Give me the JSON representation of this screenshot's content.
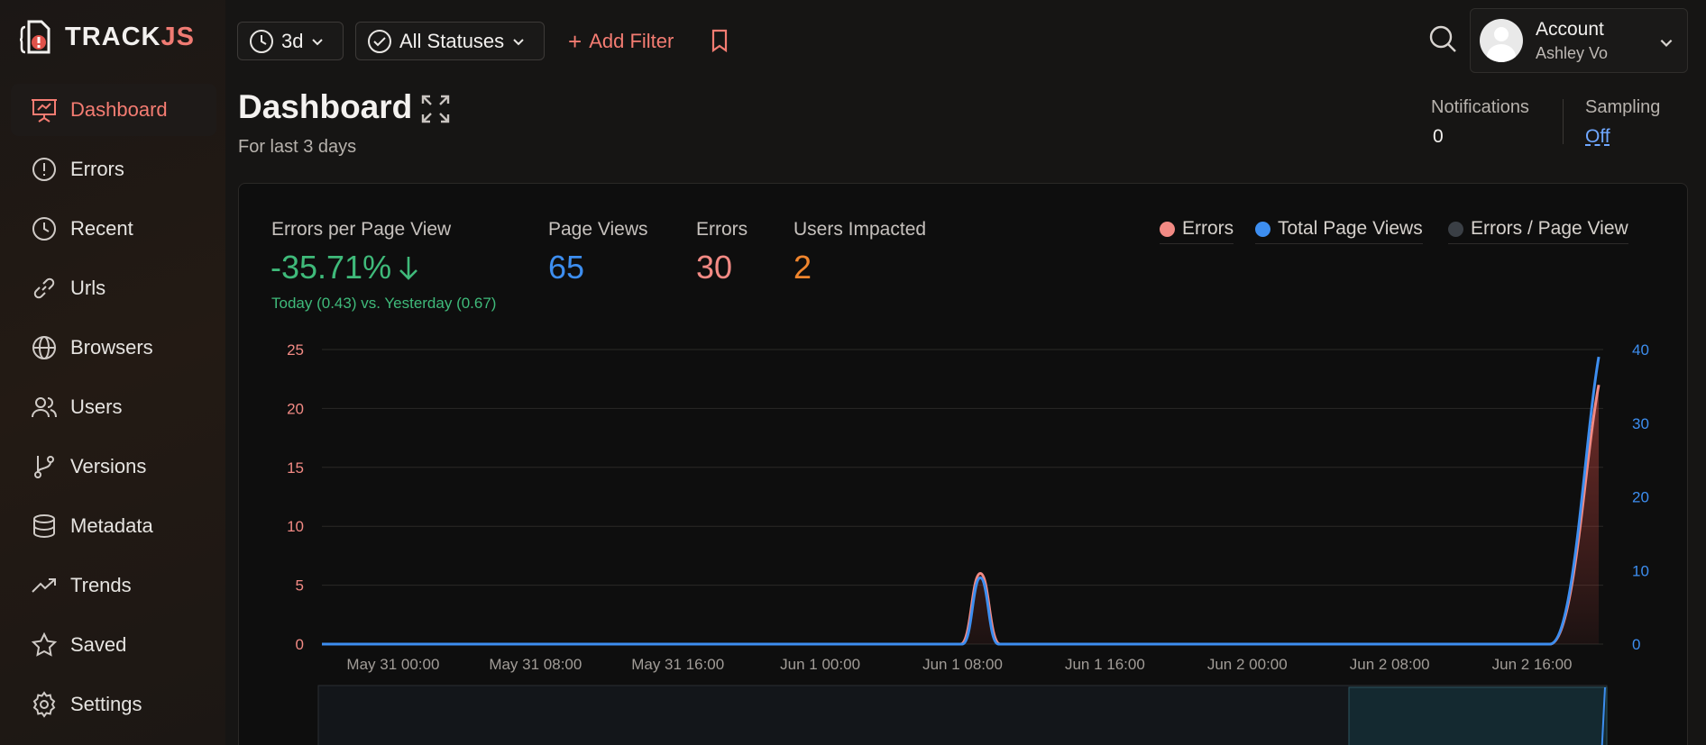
{
  "app": {
    "logo_prefix": "TRACK",
    "logo_suffix": "JS"
  },
  "sidebar": {
    "items": [
      {
        "label": "Dashboard",
        "icon": "presentation-icon",
        "active": true
      },
      {
        "label": "Errors",
        "icon": "alert-circle-icon"
      },
      {
        "label": "Recent",
        "icon": "clock-icon"
      },
      {
        "label": "Urls",
        "icon": "link-icon"
      },
      {
        "label": "Browsers",
        "icon": "globe-icon"
      },
      {
        "label": "Users",
        "icon": "users-icon"
      },
      {
        "label": "Versions",
        "icon": "git-branch-icon"
      },
      {
        "label": "Metadata",
        "icon": "database-icon"
      },
      {
        "label": "Trends",
        "icon": "trending-up-icon"
      },
      {
        "label": "Saved",
        "icon": "star-icon"
      },
      {
        "label": "Settings",
        "icon": "gear-icon"
      }
    ]
  },
  "toolbar": {
    "time_range": "3d",
    "status_filter": "All Statuses",
    "add_filter": "Add Filter"
  },
  "account": {
    "title": "Account",
    "name": "Ashley Vo"
  },
  "header": {
    "title": "Dashboard",
    "subtitle": "For last 3 days",
    "notifications_label": "Notifications",
    "notifications_value": "0",
    "sampling_label": "Sampling",
    "sampling_value": "Off"
  },
  "metrics": {
    "epv_label": "Errors per Page View",
    "epv_value": "-35.71%",
    "epv_compare": "Today (0.43) vs. Yesterday (0.67)",
    "pv_label": "Page Views",
    "pv_value": "65",
    "errors_label": "Errors",
    "errors_value": "30",
    "users_label": "Users Impacted",
    "users_value": "2"
  },
  "legend": {
    "errors": "Errors",
    "page_views": "Total Page Views",
    "epv": "Errors / Page View"
  },
  "colors": {
    "errors": "#f28a84",
    "page_views": "#3d8ef0",
    "epv": "#3a3f45",
    "positive": "#3fba7a",
    "accent": "#f47c72",
    "users": "#f0852d"
  },
  "chart_data": {
    "type": "line",
    "x_ticks": [
      "May 31 00:00",
      "May 31 08:00",
      "May 31 16:00",
      "Jun 1 00:00",
      "Jun 1 08:00",
      "Jun 1 16:00",
      "Jun 2 00:00",
      "Jun 2 08:00",
      "Jun 2 16:00"
    ],
    "x_range": [
      "May 30 20:00",
      "Jun 2 20:00"
    ],
    "y_left": {
      "range": [
        0,
        25
      ],
      "ticks": [
        0,
        5,
        10,
        15,
        20,
        25
      ]
    },
    "y_right": {
      "range": [
        0,
        40
      ],
      "ticks": [
        0,
        10,
        20,
        30,
        40
      ]
    },
    "series": [
      {
        "name": "Errors",
        "axis": "left",
        "points": [
          [
            "May 30 20:00",
            0
          ],
          [
            "Jun 1 09:00",
            6
          ],
          [
            "Jun 2 17:00",
            0
          ],
          [
            "Jun 2 19:45",
            22
          ]
        ]
      },
      {
        "name": "Total Page Views",
        "axis": "right",
        "points": [
          [
            "May 30 20:00",
            0
          ],
          [
            "Jun 1 09:00",
            9
          ],
          [
            "Jun 2 17:00",
            0
          ],
          [
            "Jun 2 19:45",
            39
          ]
        ]
      }
    ]
  }
}
